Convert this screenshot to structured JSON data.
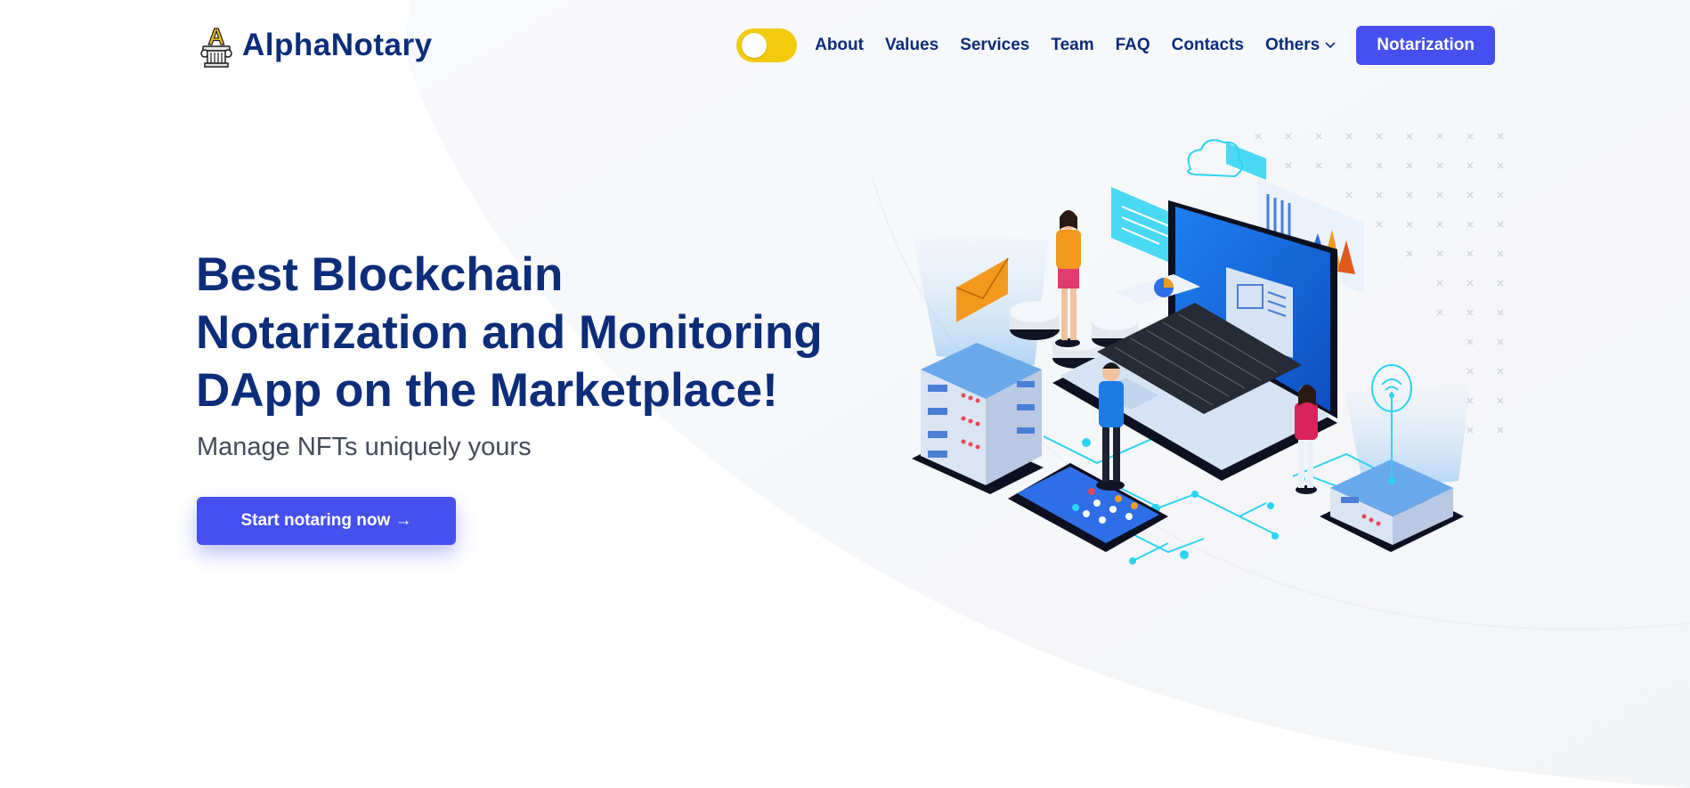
{
  "brand": {
    "name": "AlphaNotary",
    "logo_icon": "pillar-letter-a-logo"
  },
  "nav": {
    "theme_toggle_icon": "theme-toggle",
    "links": [
      "About",
      "Values",
      "Services",
      "Team",
      "FAQ",
      "Contacts"
    ],
    "dropdown_label": "Others",
    "dropdown_icon": "chevron-down-icon",
    "cta_label": "Notarization"
  },
  "hero": {
    "title_lines": [
      "Best Blockchain",
      "Notarization and Monitoring",
      "DApp on the Marketplace!"
    ],
    "subtitle": "Manage NFTs uniquely yours",
    "cta_label": "Start notaring now →",
    "illustration": "isometric-blockchain-laptop-illustration"
  },
  "colors": {
    "primary": "#4650ee",
    "heading": "#0b2d7a",
    "toggle": "#f1cb0c",
    "body_text": "#444a58",
    "accent_cyan": "#2bd3f2"
  }
}
